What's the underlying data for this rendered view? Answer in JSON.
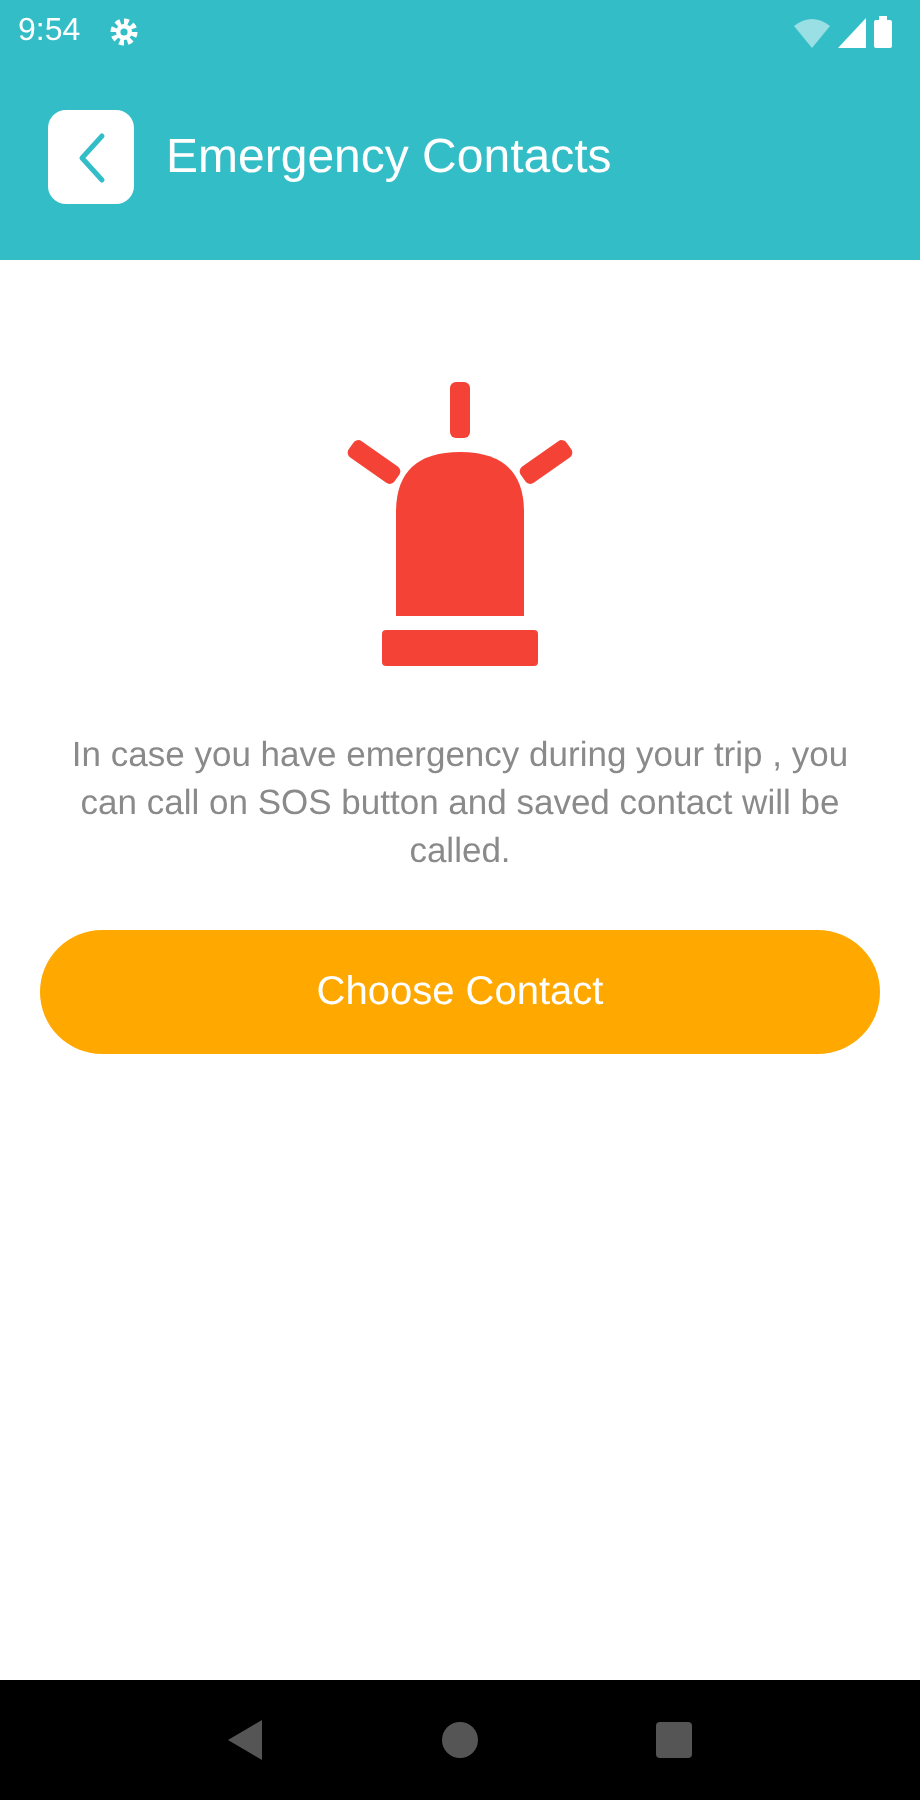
{
  "status_bar": {
    "time": "9:54"
  },
  "header": {
    "title": "Emergency Contacts"
  },
  "message": "In case you have emergency during your trip , you can call on SOS button and saved contact will be called.",
  "button": {
    "label": "Choose Contact"
  }
}
